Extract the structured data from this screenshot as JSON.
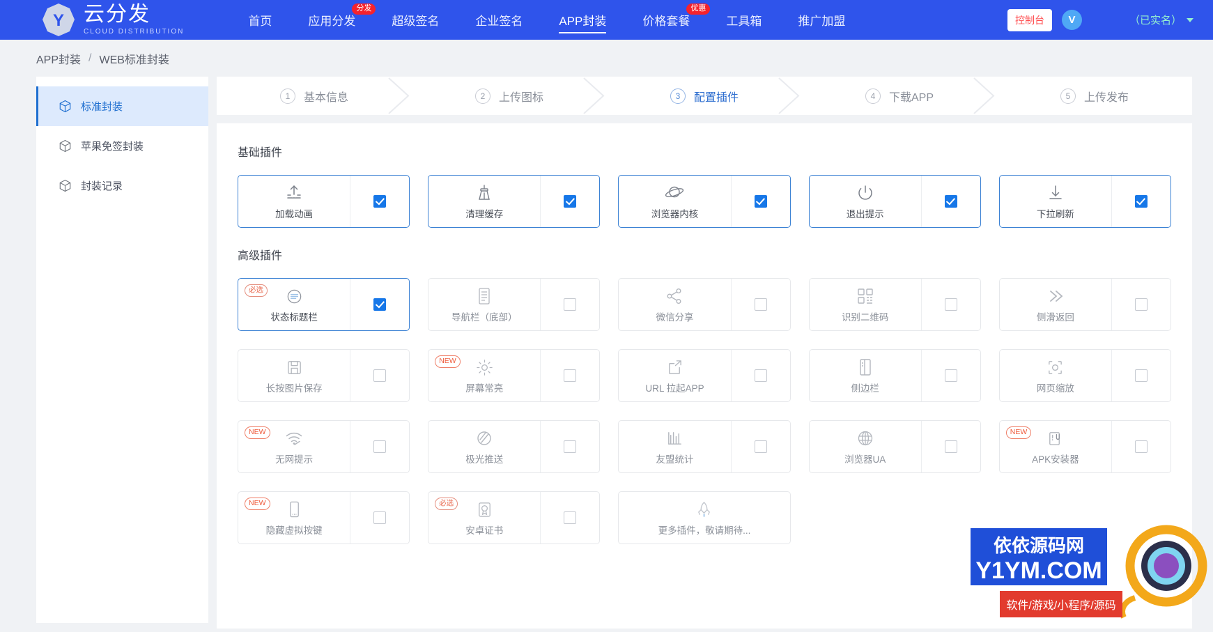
{
  "nav": {
    "logo": {
      "cn": "云分发",
      "en": "CLOUD DISTRIBUTION",
      "mark": "Y"
    },
    "items": [
      {
        "label": "首页",
        "badge": null,
        "active": false
      },
      {
        "label": "应用分发",
        "badge": "分发",
        "active": false
      },
      {
        "label": "超级签名",
        "badge": null,
        "active": false
      },
      {
        "label": "企业签名",
        "badge": null,
        "active": false
      },
      {
        "label": "APP封装",
        "badge": null,
        "active": true
      },
      {
        "label": "价格套餐",
        "badge": "优惠",
        "active": false
      },
      {
        "label": "工具箱",
        "badge": null,
        "active": false
      },
      {
        "label": "推广加盟",
        "badge": null,
        "active": false
      }
    ],
    "console_label": "控制台",
    "avatar_letter": "V",
    "realname_label": "（已实名）"
  },
  "breadcrumb": {
    "parent": "APP封装",
    "separator": "/",
    "current": "WEB标准封装"
  },
  "sidebar": {
    "items": [
      {
        "label": "标准封装",
        "icon": "cube-icon",
        "active": true
      },
      {
        "label": "苹果免签封装",
        "icon": "cube-icon",
        "active": false
      },
      {
        "label": "封装记录",
        "icon": "cube-icon",
        "active": false
      }
    ]
  },
  "steps": [
    {
      "num": "1",
      "label": "基本信息",
      "active": false
    },
    {
      "num": "2",
      "label": "上传图标",
      "active": false
    },
    {
      "num": "3",
      "label": "配置插件",
      "active": true
    },
    {
      "num": "4",
      "label": "下载APP",
      "active": false
    },
    {
      "num": "5",
      "label": "上传发布",
      "active": false
    }
  ],
  "panel": {
    "basic_title": "基础插件",
    "advanced_title": "高级插件",
    "basic_plugins": [
      {
        "label": "加载动画",
        "icon": "upload-arrow-icon",
        "checked": true,
        "selected": true,
        "tag": null
      },
      {
        "label": "清理缓存",
        "icon": "broom-icon",
        "checked": true,
        "selected": true,
        "tag": null
      },
      {
        "label": "浏览器内核",
        "icon": "planet-icon",
        "checked": true,
        "selected": true,
        "tag": null
      },
      {
        "label": "退出提示",
        "icon": "power-icon",
        "checked": true,
        "selected": true,
        "tag": null
      },
      {
        "label": "下拉刷新",
        "icon": "download-arrow-icon",
        "checked": true,
        "selected": true,
        "tag": null
      }
    ],
    "advanced_plugins": [
      {
        "label": "状态标题栏",
        "icon": "status-bar-icon",
        "checked": true,
        "selected": true,
        "tag": "必选"
      },
      {
        "label": "导航栏（底部）",
        "icon": "nav-bar-icon",
        "checked": false,
        "selected": false,
        "tag": null
      },
      {
        "label": "微信分享",
        "icon": "share-icon",
        "checked": false,
        "selected": false,
        "tag": null
      },
      {
        "label": "识别二维码",
        "icon": "qrcode-icon",
        "checked": false,
        "selected": false,
        "tag": null
      },
      {
        "label": "侧滑返回",
        "icon": "chevrons-right-icon",
        "checked": false,
        "selected": false,
        "tag": null
      },
      {
        "label": "长按图片保存",
        "icon": "save-icon",
        "checked": false,
        "selected": false,
        "tag": null
      },
      {
        "label": "屏幕常亮",
        "icon": "sun-icon",
        "checked": false,
        "selected": false,
        "tag": "NEW"
      },
      {
        "label": "URL 拉起APP",
        "icon": "external-link-icon",
        "checked": false,
        "selected": false,
        "tag": null
      },
      {
        "label": "侧边栏",
        "icon": "sidebar-icon",
        "checked": false,
        "selected": false,
        "tag": null
      },
      {
        "label": "网页缩放",
        "icon": "zoom-frame-icon",
        "checked": false,
        "selected": false,
        "tag": null
      },
      {
        "label": "无网提示",
        "icon": "no-wifi-icon",
        "checked": false,
        "selected": false,
        "tag": "NEW"
      },
      {
        "label": "极光推送",
        "icon": "aurora-push-icon",
        "checked": false,
        "selected": false,
        "tag": null
      },
      {
        "label": "友盟统计",
        "icon": "bar-stats-icon",
        "checked": false,
        "selected": false,
        "tag": null
      },
      {
        "label": "浏览器UA",
        "icon": "globe-icon",
        "checked": false,
        "selected": false,
        "tag": null
      },
      {
        "label": "APK安装器",
        "icon": "apk-installer-icon",
        "checked": false,
        "selected": false,
        "tag": "NEW"
      },
      {
        "label": "隐藏虚拟按键",
        "icon": "phone-icon",
        "checked": false,
        "selected": false,
        "tag": "NEW"
      },
      {
        "label": "安卓证书",
        "icon": "certificate-icon",
        "checked": false,
        "selected": false,
        "tag": "必选"
      },
      {
        "label": "更多插件，敬请期待...",
        "icon": "rocket-icon",
        "checked": null,
        "selected": false,
        "tag": null
      }
    ]
  },
  "watermark": {
    "site_cn": "依依源码网",
    "site_url": "Y1YM.COM",
    "tagline": "软件/游戏/小程序/源码"
  },
  "colors": {
    "brand": "#2f54eb",
    "accent": "#1677e8",
    "badge_red": "#f5222d",
    "tag_orange": "#e8654a",
    "green": "#95f0cf"
  }
}
